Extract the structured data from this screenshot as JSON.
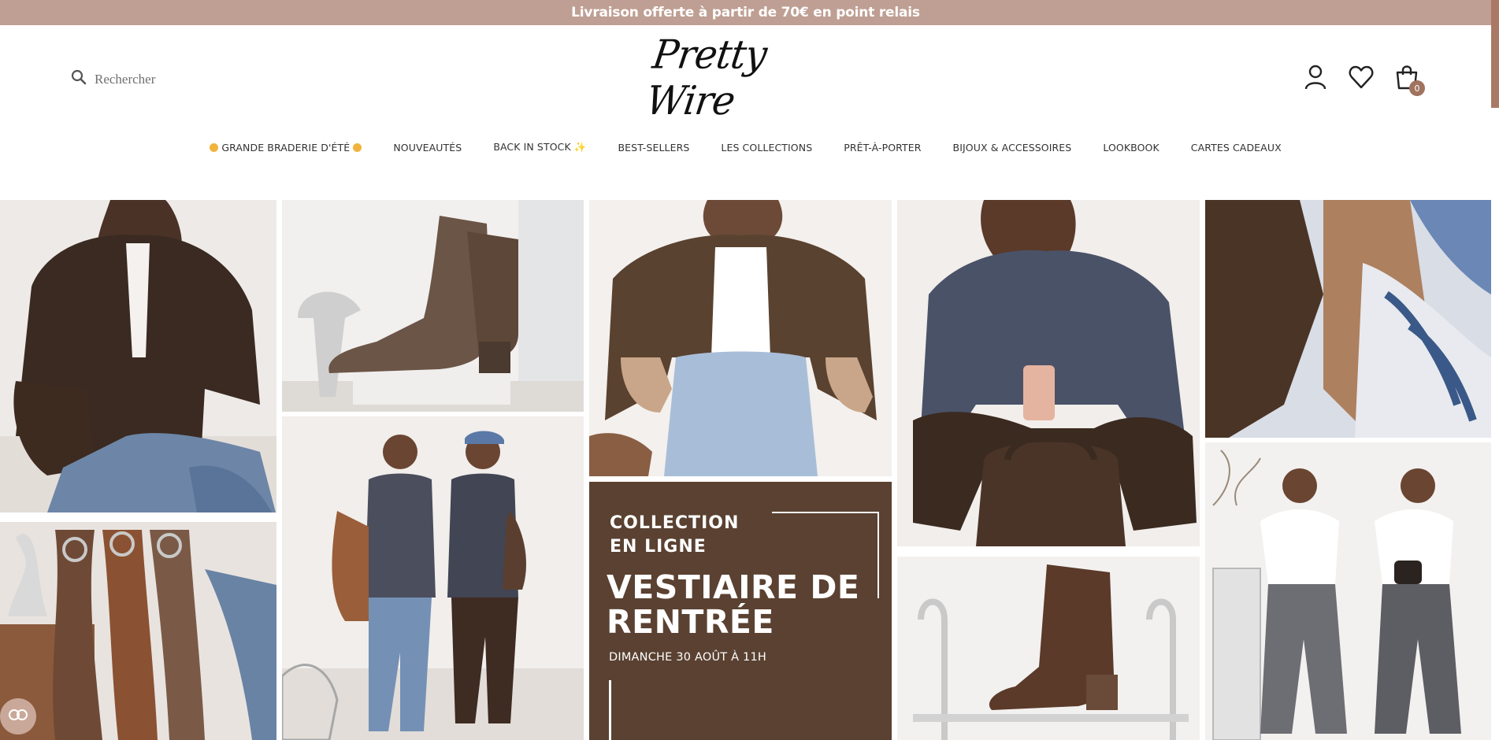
{
  "announcement": {
    "text": "Livraison offerte à partir de 70€ en point relais"
  },
  "header": {
    "search": {
      "placeholder": "Rechercher"
    },
    "logo": {
      "text": "Pretty Wire"
    },
    "cart": {
      "count": "0"
    }
  },
  "nav": {
    "items": [
      {
        "label": "GRANDE BRADERIE D'ÉTÉ",
        "has_dots": true
      },
      {
        "label": "NOUVEAUTÉS"
      },
      {
        "label": "BACK IN STOCK ✨"
      },
      {
        "label": "BEST-SELLERS"
      },
      {
        "label": "LES COLLECTIONS"
      },
      {
        "label": "PRÊT-À-PORTER"
      },
      {
        "label": "BIJOUX & ACCESSOIRES"
      },
      {
        "label": "LOOKBOOK"
      },
      {
        "label": "CARTES CADEAUX"
      }
    ]
  },
  "promo": {
    "kicker_line1": "COLLECTION",
    "kicker_line2": "EN LIGNE",
    "title_line1": "VESTIAIRE DE",
    "title_line2": "RENTRÉE",
    "date": "DIMANCHE 30 AOÛT À 11H"
  },
  "colors": {
    "announcement_bg": "#bf9f93",
    "promo_bg": "#5a4131",
    "accent": "#a0735f"
  },
  "icons": [
    "search-icon",
    "account-icon",
    "heart-icon",
    "cart-icon",
    "cookie-icon"
  ]
}
